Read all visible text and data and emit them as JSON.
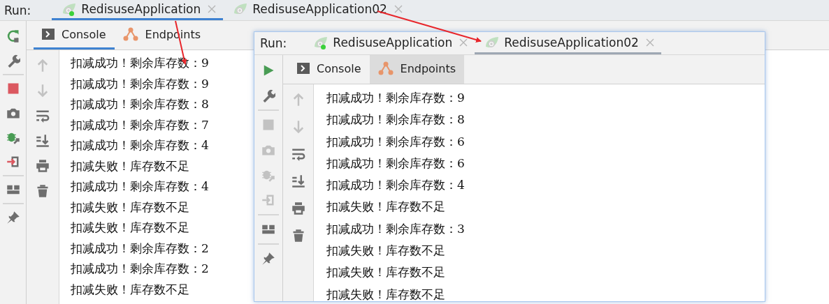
{
  "panels": [
    {
      "focused": true,
      "run_label": "Run:",
      "run_tabs": [
        {
          "label": "RedisuseApplication",
          "selected": true,
          "running": true
        },
        {
          "label": "RedisuseApplication02",
          "selected": false,
          "running": false
        }
      ],
      "left_toolbar": [
        {
          "kind": "rerun",
          "disabled": false
        },
        {
          "kind": "wrench",
          "disabled": false
        },
        {
          "kind": "separator"
        },
        {
          "kind": "stop",
          "disabled": false
        },
        {
          "kind": "camera",
          "disabled": false
        },
        {
          "kind": "debug",
          "disabled": false
        },
        {
          "kind": "exit",
          "disabled": false
        },
        {
          "kind": "separator"
        },
        {
          "kind": "layout",
          "disabled": false
        },
        {
          "kind": "separator"
        },
        {
          "kind": "pin",
          "disabled": false
        }
      ],
      "sub_tabs": [
        {
          "label": "Console",
          "kind": "console",
          "selected": true
        },
        {
          "label": "Endpoints",
          "kind": "endpoints",
          "selected": false
        }
      ],
      "console_toolbar": [
        {
          "kind": "up",
          "disabled": true
        },
        {
          "kind": "down",
          "disabled": true
        },
        {
          "kind": "wrap",
          "disabled": false
        },
        {
          "kind": "scroll_end",
          "disabled": false
        },
        {
          "kind": "print",
          "disabled": false
        },
        {
          "kind": "trash",
          "disabled": false
        }
      ],
      "console_lines": [
        "扣减成功！剩余库存数：9",
        "扣减成功！剩余库存数：9",
        "扣减成功！剩余库存数：8",
        "扣减成功！剩余库存数：7",
        "扣减成功！剩余库存数：4",
        "扣减失败！库存数不足",
        "扣减成功！剩余库存数：4",
        "扣减失败！库存数不足",
        "扣减失败！库存数不足",
        "扣减成功！剩余库存数：2",
        "扣减成功！剩余库存数：2",
        "扣减失败！库存数不足"
      ]
    },
    {
      "focused": false,
      "run_label": "Run:",
      "run_tabs": [
        {
          "label": "RedisuseApplication",
          "selected": false,
          "running": true
        },
        {
          "label": "RedisuseApplication02",
          "selected": true,
          "running": false
        }
      ],
      "left_toolbar": [
        {
          "kind": "run",
          "disabled": false
        },
        {
          "kind": "wrench",
          "disabled": false
        },
        {
          "kind": "separator"
        },
        {
          "kind": "stop",
          "disabled": true
        },
        {
          "kind": "camera",
          "disabled": true
        },
        {
          "kind": "debug",
          "disabled": true
        },
        {
          "kind": "exit",
          "disabled": true
        },
        {
          "kind": "separator"
        },
        {
          "kind": "layout",
          "disabled": false
        },
        {
          "kind": "separator"
        },
        {
          "kind": "pin",
          "disabled": false
        }
      ],
      "sub_tabs": [
        {
          "label": "Console",
          "kind": "console",
          "selected": false
        },
        {
          "label": "Endpoints",
          "kind": "endpoints",
          "selected": true
        }
      ],
      "console_toolbar": [
        {
          "kind": "up",
          "disabled": true
        },
        {
          "kind": "down",
          "disabled": true
        },
        {
          "kind": "wrap",
          "disabled": false
        },
        {
          "kind": "scroll_end",
          "disabled": false
        },
        {
          "kind": "print",
          "disabled": false
        },
        {
          "kind": "trash",
          "disabled": false
        }
      ],
      "console_lines": [
        "扣减成功！剩余库存数：9",
        "扣减成功！剩余库存数：8",
        "扣减成功！剩余库存数：6",
        "扣减成功！剩余库存数：6",
        "扣减成功！剩余库存数：4",
        "扣减失败！库存数不足",
        "扣减成功！剩余库存数：3",
        "扣减失败！库存数不足",
        "扣减失败！库存数不足",
        "扣减失败！库存数不足"
      ]
    }
  ]
}
